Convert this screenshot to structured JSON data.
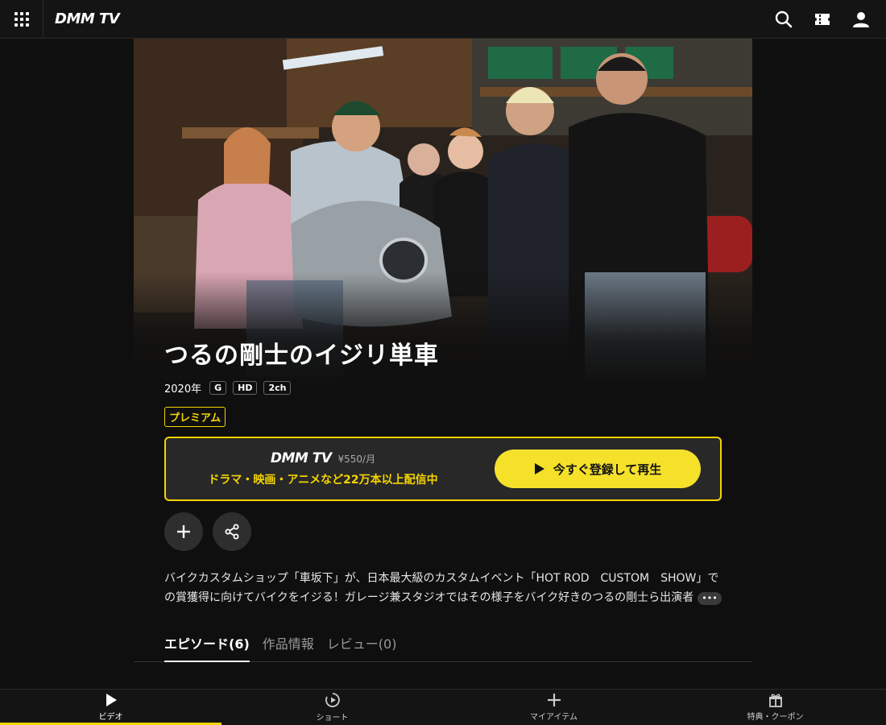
{
  "header": {
    "logo": "DMM TV",
    "icons": [
      "grid-menu-icon",
      "search-icon",
      "ticket-icon",
      "user-icon"
    ]
  },
  "hero": {
    "image": "cast-photo-garage"
  },
  "title": "つるの剛士のイジリ単車",
  "meta": {
    "year": "2020年",
    "badges": [
      "G",
      "HD",
      "2ch"
    ]
  },
  "premium_label": "プレミアム",
  "promo": {
    "logo": "DMM TV",
    "price": "¥550/月",
    "tagline": "ドラマ・映画・アニメなど22万本以上配信中",
    "button_label": "今すぐ登録して再生"
  },
  "actions": [
    "add-icon",
    "share-icon"
  ],
  "description": "バイクカスタムショップ「車坂下」が、日本最大級のカスタムイベント「HOT ROD　CUSTOM　SHOW」での賞獲得に向けてバイクをイジる！ガレージ兼スタジオではその様子をバイク好きのつるの剛士ら出演者",
  "more_label": "•••",
  "tabs": [
    {
      "label": "エピソード(6)",
      "active": true
    },
    {
      "label": "作品情報",
      "active": false
    },
    {
      "label": "レビュー(0)",
      "active": false
    }
  ],
  "bottom_nav": [
    {
      "label": "ビデオ",
      "icon": "play-icon",
      "active": true
    },
    {
      "label": "ショート",
      "icon": "short-play-icon",
      "active": false
    },
    {
      "label": "マイアイテム",
      "icon": "plus-icon",
      "active": false
    },
    {
      "label": "特典・クーポン",
      "icon": "gift-icon",
      "active": false
    }
  ],
  "colors": {
    "accent": "#f5d400",
    "button": "#f5e12a",
    "background": "#0f0f0f"
  }
}
